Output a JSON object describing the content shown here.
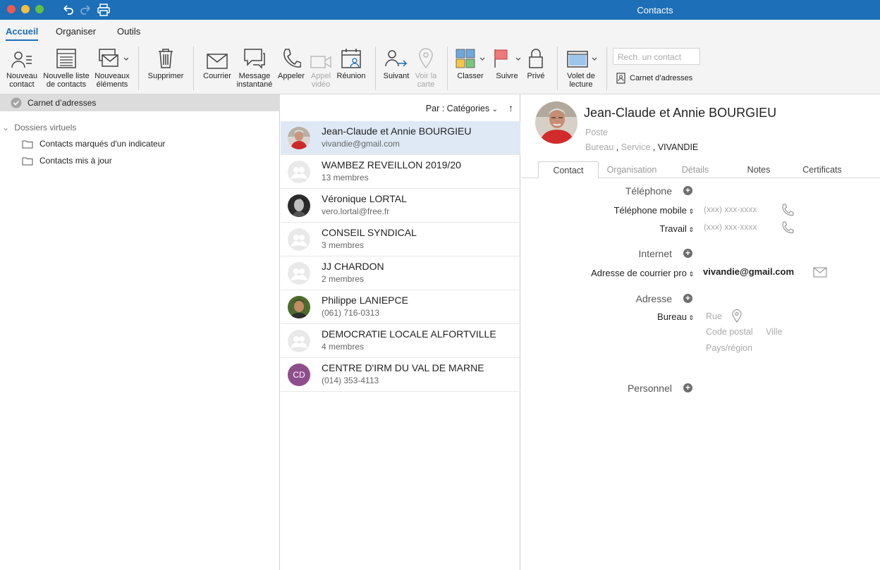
{
  "window": {
    "title": "Contacts"
  },
  "ribbon_tabs": [
    "Accueil",
    "Organiser",
    "Outils"
  ],
  "toolbar": {
    "new_contact": "Nouveau\ncontact",
    "new_list": "Nouvelle liste\nde contacts",
    "new_items": "Nouveaux\néléments",
    "delete": "Supprimer",
    "mail": "Courrier",
    "im": "Message\ninstantané",
    "call": "Appeler",
    "video": "Appel\nvidéo",
    "meeting": "Réunion",
    "follow": "Suivant",
    "map": "Voir la\ncarte",
    "categorize": "Classer",
    "follow_up": "Suivre",
    "private": "Privé",
    "reading_pane": "Volet de\nlecture",
    "search_placeholder": "Rech. un contact",
    "address_book": "Carnet d’adresses"
  },
  "sidebar": {
    "selected": "Carnet d’adresses",
    "virtual_folders_header": "Dossiers virtuels",
    "folders": [
      "Contacts marqués d'un indicateur",
      "Contacts mis à jour"
    ]
  },
  "list": {
    "sort_label": "Par : Catégories",
    "contacts": [
      {
        "name": "Jean-Claude et Annie BOURGIEU",
        "sub": "vivandie@gmail.com",
        "avatar": "photo-man-red"
      },
      {
        "name": "WAMBEZ REVEILLON 2019/20",
        "sub": "13 membres",
        "avatar": "group"
      },
      {
        "name": "Véronique LORTAL",
        "sub": "vero.lortal@free.fr",
        "avatar": "photo-woman-bw"
      },
      {
        "name": "CONSEIL SYNDICAL",
        "sub": "3 membres",
        "avatar": "group"
      },
      {
        "name": "JJ CHARDON",
        "sub": "2 membres",
        "avatar": "group"
      },
      {
        "name": "Philippe LANIEPCE",
        "sub": "(061) 716-0313",
        "avatar": "photo-man-green"
      },
      {
        "name": "DEMOCRATIE LOCALE ALFORTVILLE",
        "sub": "4 membres",
        "avatar": "group"
      },
      {
        "name": "CENTRE D'IRM DU VAL DE MARNE",
        "sub": "(014) 353-4113",
        "avatar": "initials",
        "initials": "CD"
      }
    ]
  },
  "detail": {
    "full_name": "Jean-Claude et Annie  BOURGIEU",
    "job_title_placeholder": "Poste",
    "office_placeholder": "Bureau",
    "service_placeholder": "Service",
    "company": "VIVANDIE",
    "tabs": [
      "Contact",
      "Organisation",
      "Détails",
      "Notes",
      "Certificats"
    ],
    "phone_section": "Téléphone",
    "mobile_label": "Téléphone mobile",
    "mobile_placeholder": "(xxx) xxx-xxxx",
    "work_label": "Travail",
    "work_placeholder": "(xxx) xxx-xxxx",
    "internet_section": "Internet",
    "email_label": "Adresse de courrier pro",
    "email_value": "vivandie@gmail.com",
    "address_section": "Adresse",
    "address_label": "Bureau",
    "street_placeholder": "Rue",
    "postal_placeholder": "Code postal",
    "city_placeholder": "Ville",
    "country_placeholder": "Pays/région",
    "personal_section": "Personnel"
  },
  "colors": {
    "accent": "#1d6fb7",
    "selected_row": "#dfe9f5",
    "initials_avatar": "#8e4d8c"
  }
}
